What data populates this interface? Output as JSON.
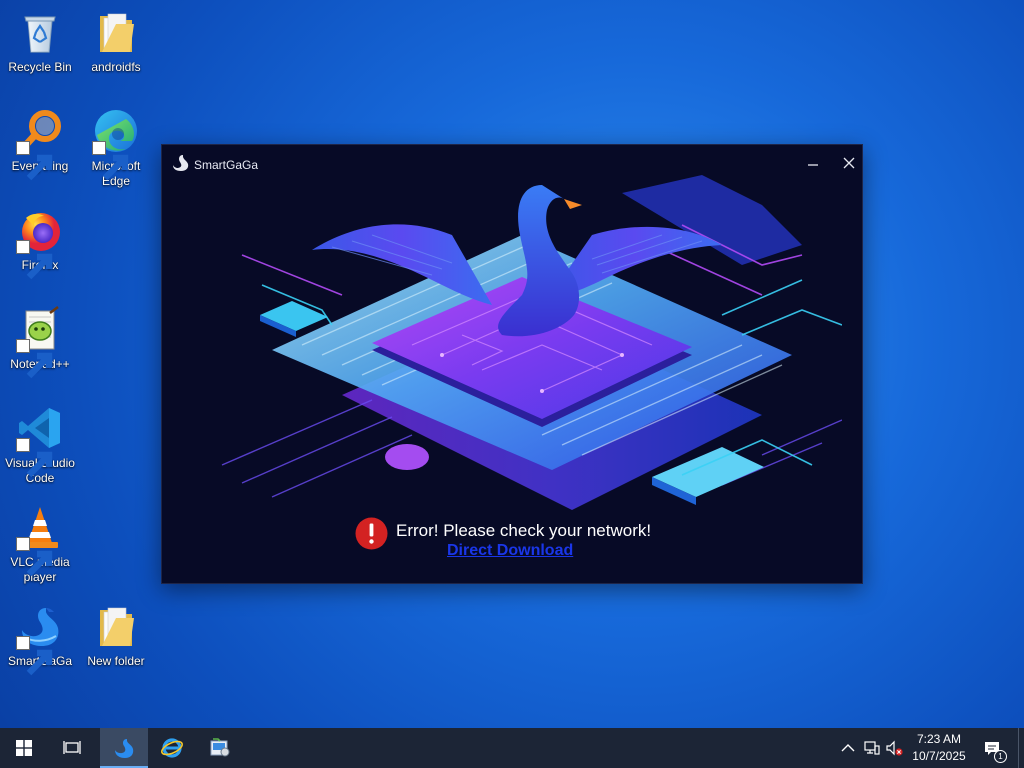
{
  "desktop": {
    "icons": [
      {
        "label": "Recycle Bin"
      },
      {
        "label": "androidfs"
      },
      {
        "label": "Everything"
      },
      {
        "label": "Microsoft Edge"
      },
      {
        "label": "Firefox"
      },
      {
        "label": "Notepad++"
      },
      {
        "label": "Visual Studio Code"
      },
      {
        "label": "VLC media player"
      },
      {
        "label": "SmartGaGa"
      },
      {
        "label": "New folder"
      }
    ]
  },
  "window": {
    "title": "SmartGaGa",
    "error_message": "Error! Please check your network!",
    "download_link": "Direct Download"
  },
  "taskbar": {
    "time": "7:23 AM",
    "date": "10/7/2025",
    "notification_count": "1"
  },
  "colors": {
    "window_bg": "#070a26",
    "error_red": "#d32222",
    "link_blue": "#1a36e8",
    "taskbar_bg": "#1c2536"
  }
}
